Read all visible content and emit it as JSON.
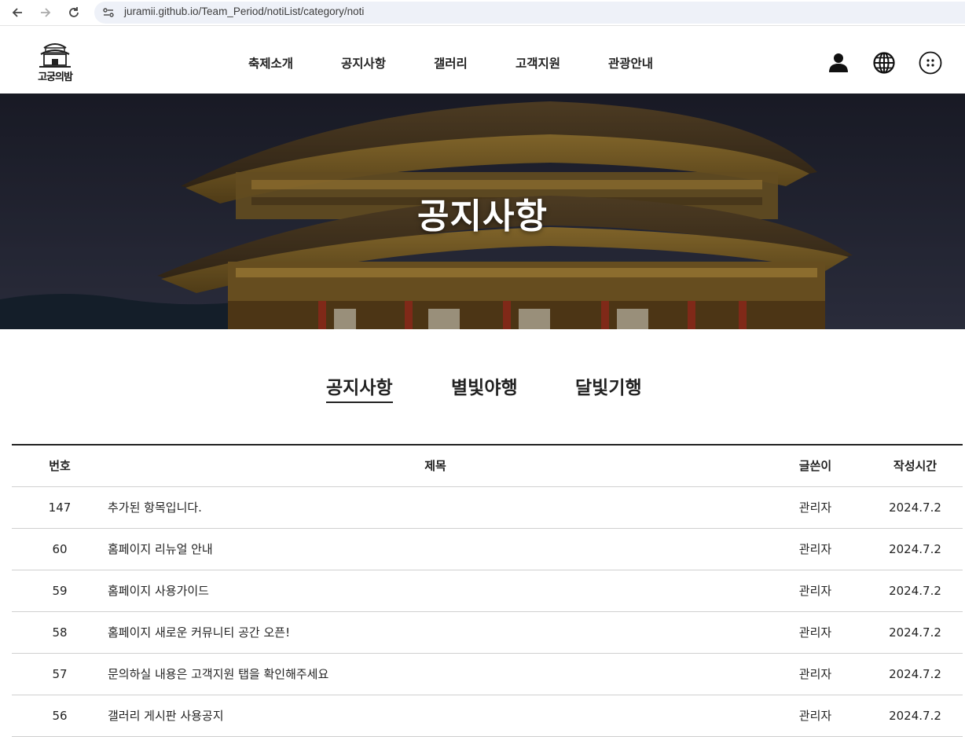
{
  "browser": {
    "url": "juramii.github.io/Team_Period/notiList/category/noti"
  },
  "site": {
    "logo_text": "고궁의밤",
    "nav": [
      "축제소개",
      "공지사항",
      "갤러리",
      "고객지원",
      "관광안내"
    ]
  },
  "hero": {
    "title": "공지사항"
  },
  "tabs": [
    "공지사항",
    "별빛야행",
    "달빛기행"
  ],
  "table": {
    "headers": {
      "num": "번호",
      "title": "제목",
      "writer": "글쓴이",
      "time": "작성시간"
    },
    "rows": [
      {
        "num": "147",
        "title": "추가된 항목입니다.",
        "writer": "관리자",
        "time": "2024.7.2"
      },
      {
        "num": "60",
        "title": "홈페이지 리뉴얼 안내",
        "writer": "관리자",
        "time": "2024.7.2"
      },
      {
        "num": "59",
        "title": "홈페이지 사용가이드",
        "writer": "관리자",
        "time": "2024.7.2"
      },
      {
        "num": "58",
        "title": "홈페이지 새로운 커뮤니티 공간 오픈!",
        "writer": "관리자",
        "time": "2024.7.2"
      },
      {
        "num": "57",
        "title": "문의하실 내용은 고객지원 탭을 확인해주세요",
        "writer": "관리자",
        "time": "2024.7.2"
      },
      {
        "num": "56",
        "title": "갤러리 게시판 사용공지",
        "writer": "관리자",
        "time": "2024.7.2"
      }
    ]
  },
  "icons": {
    "back": "back-arrow-icon",
    "forward": "forward-arrow-icon",
    "reload": "reload-icon",
    "site_settings": "site-settings-icon",
    "user": "user-icon",
    "language": "globe-icon",
    "menu": "grid-menu-icon"
  }
}
